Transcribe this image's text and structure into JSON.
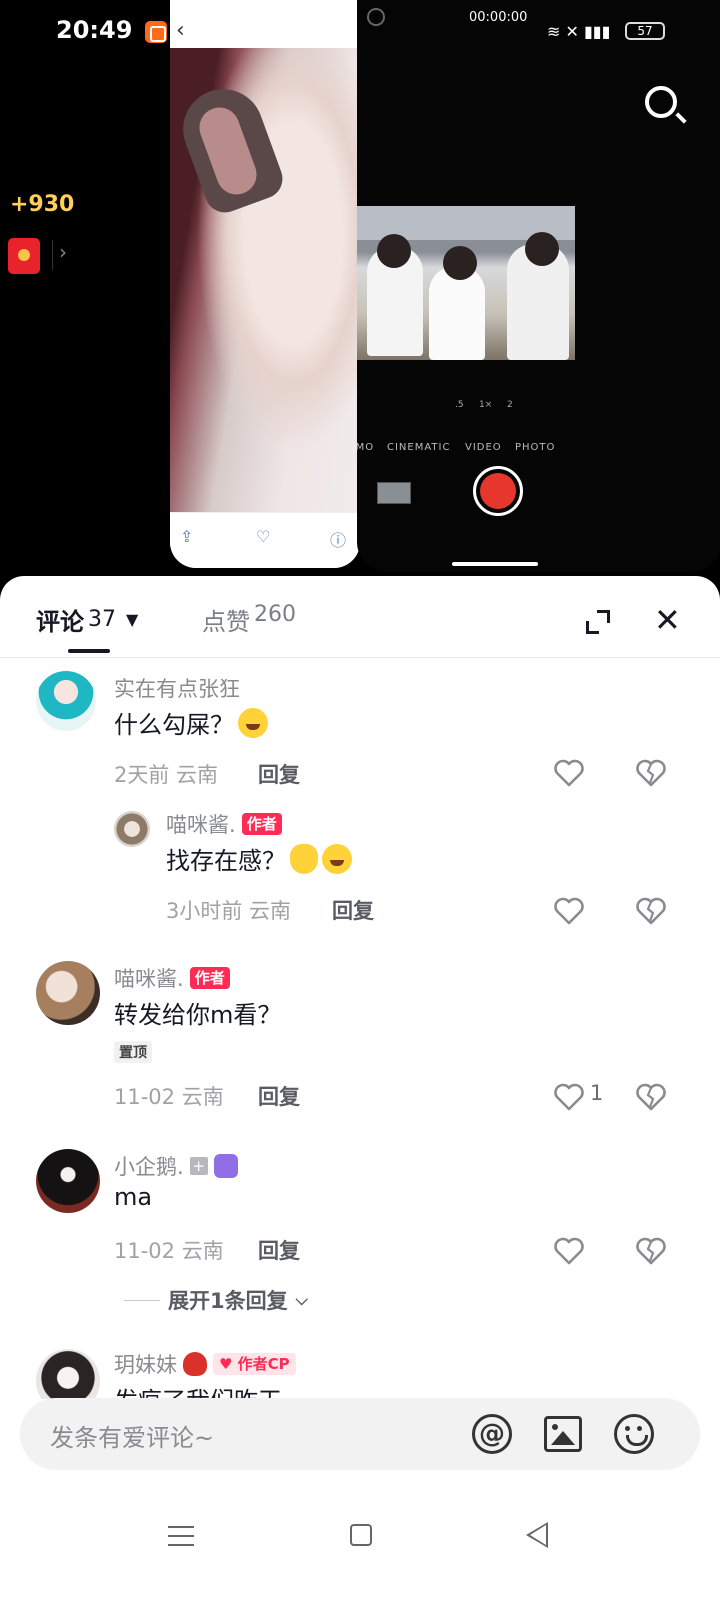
{
  "status_bar": {
    "time": "20:49"
  },
  "overlay": {
    "coin_bonus": "+930"
  },
  "camera": {
    "timer": "00:00:00",
    "battery": "57",
    "zoom_levels": [
      ".5",
      "1×",
      "2"
    ],
    "modes": [
      "-MO",
      "CINEMATIC",
      "VIDEO",
      "PHOTO"
    ]
  },
  "header": {
    "comments_label": "评论",
    "comments_count": "37",
    "likes_label": "点赞",
    "likes_count": "260"
  },
  "comments": [
    {
      "user": "实在有点张狂",
      "text": "什么勾屎？",
      "time_loc": "2天前 云南",
      "reply": "回复"
    },
    {
      "user": "喵咪酱.",
      "tag": "作者",
      "text": "找存在感？",
      "time_loc": "3小时前 云南",
      "reply": "回复"
    },
    {
      "user": "喵咪酱.",
      "tag": "作者",
      "text": "转发给你m看？",
      "pin": "置顶",
      "time_loc": "11-02 云南",
      "reply": "回复",
      "likes": "1"
    },
    {
      "user": "小企鹅.",
      "text": "ma",
      "time_loc": "11-02 云南",
      "reply": "回复",
      "expand": "展开1条回复"
    },
    {
      "user": "玥妹妹",
      "tag": "作者CP",
      "text": "发疯了我们昨天"
    }
  ],
  "input": {
    "placeholder": "发条有爱评论~"
  },
  "colors": {
    "accent": "#fe2c55",
    "text_primary": "#161823",
    "text_secondary": "#8a8b91"
  }
}
